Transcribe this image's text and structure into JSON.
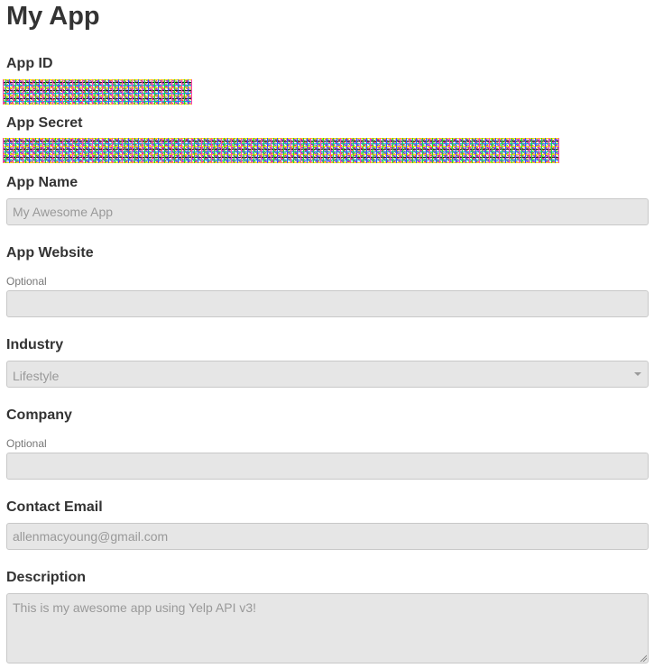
{
  "page": {
    "title": "My App"
  },
  "app_id": {
    "label": "App ID"
  },
  "app_secret": {
    "label": "App Secret"
  },
  "app_name": {
    "label": "App Name",
    "value": "My Awesome App"
  },
  "app_website": {
    "label": "App Website",
    "hint": "Optional",
    "value": ""
  },
  "industry": {
    "label": "Industry",
    "selected": "Lifestyle"
  },
  "company": {
    "label": "Company",
    "hint": "Optional",
    "value": ""
  },
  "contact_email": {
    "label": "Contact Email",
    "value": "allenmacyoung@gmail.com"
  },
  "description": {
    "label": "Description",
    "value": "This is my awesome app using Yelp API v3!"
  },
  "colors": {
    "field_background": "#e6e6e6",
    "field_border": "#c8c8c8",
    "field_text": "#999999",
    "label_text": "#333333",
    "hint_text": "#777777"
  }
}
